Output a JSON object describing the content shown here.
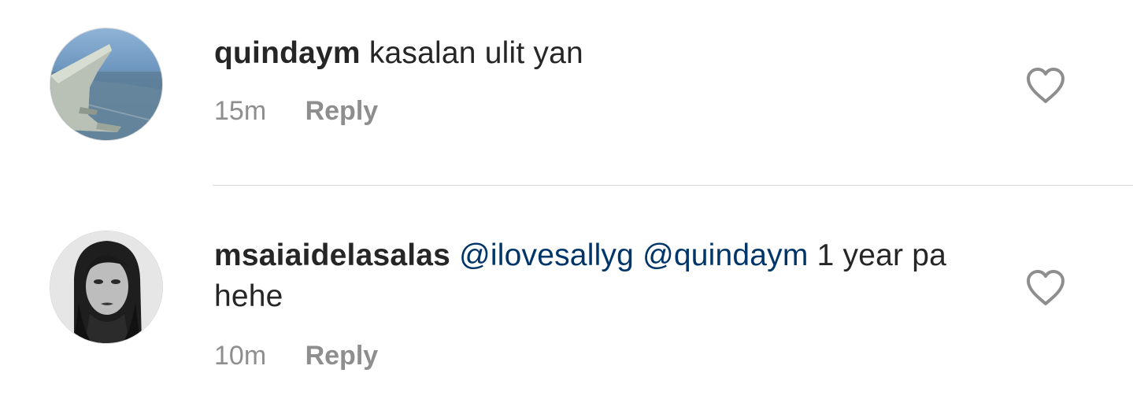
{
  "comments": [
    {
      "avatar_icon": "airplane-wing-photo",
      "username": "quindaym",
      "text": "kasalan ulit yan",
      "time": "15m",
      "reply_label": "Reply",
      "like_icon": "heart-outline-icon"
    },
    {
      "avatar_icon": "woman-portrait-photo",
      "username": "msaiaidelasalas",
      "mentions": [
        "@ilovesallyg",
        "@quindaym"
      ],
      "text": "1 year pa hehe",
      "time": "10m",
      "reply_label": "Reply",
      "like_icon": "heart-outline-icon"
    }
  ],
  "colors": {
    "text": "#262626",
    "muted": "#8e8e8e",
    "mention": "#003569",
    "divider": "#dbdbdb"
  }
}
